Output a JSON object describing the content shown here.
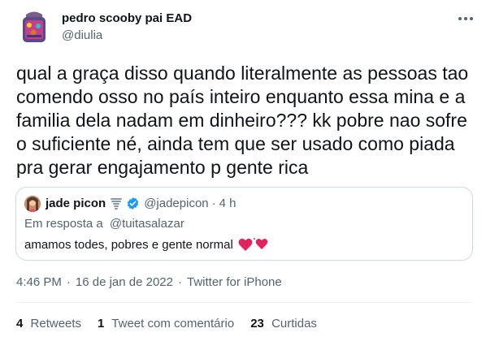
{
  "author": {
    "display_name": "pedro scooby pai EAD",
    "handle": "@diulia"
  },
  "tweet": {
    "text": "qual a graça disso quando literalmente as pessoas tao comendo osso no país inteiro enquanto essa mina e a familia dela nadam em dinheiro??? kk pobre nao sofre o suficiente né, ainda tem que ser usado como piada pra gerar engajamento p gente rica"
  },
  "quoted_tweet": {
    "display_name": "jade picon",
    "handle": "@jadepicon",
    "separator": "·",
    "time": "4 h",
    "reply_prefix": "Em resposta a",
    "reply_mention": "@tuitasalazar",
    "text": "amamos todes, pobres e gente normal"
  },
  "meta": {
    "time": "4:46 PM",
    "separator": "·",
    "date": "16 de jan de 2022",
    "source": "Twitter for iPhone"
  },
  "stats": [
    {
      "count": "4",
      "label": "Retweets"
    },
    {
      "count": "1",
      "label": "Tweet com comentário"
    },
    {
      "count": "23",
      "label": "Curtidas"
    }
  ],
  "colors": {
    "text_primary": "#0f1419",
    "text_secondary": "#536471",
    "border": "#cfd9de",
    "verified": "#1d9bf0",
    "heart": "#e0245e"
  },
  "icons": {
    "more": "more-icon",
    "tornado": "tornado-icon",
    "verified": "verified-badge-icon",
    "hearts": "two-hearts-icon"
  }
}
